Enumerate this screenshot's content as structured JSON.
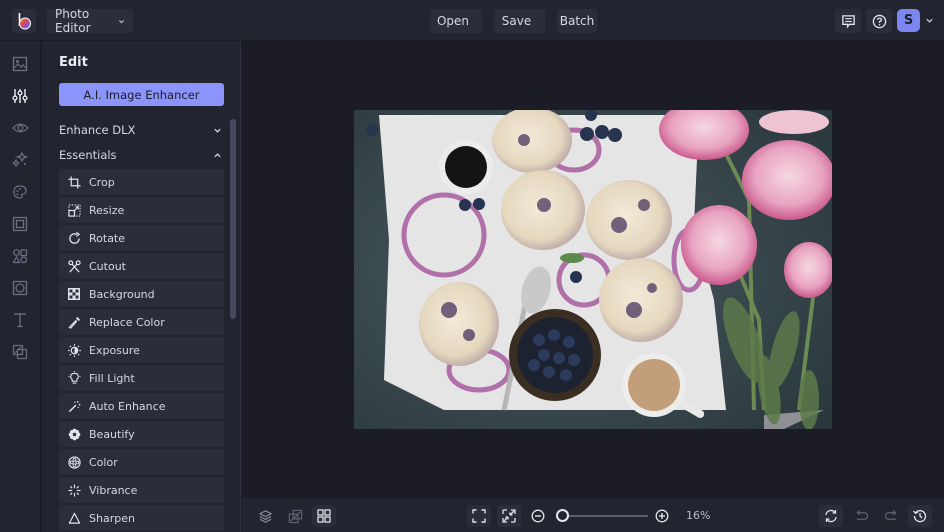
{
  "app": {
    "logo": "befunky-logo",
    "mode_selector": {
      "label": "Photo Editor",
      "icon": "chevron-down-icon"
    }
  },
  "topbar": {
    "menu": [
      {
        "label": "Open",
        "icon": "chevron-down-icon"
      },
      {
        "label": "Save",
        "icon": "chevron-down-icon"
      },
      {
        "label": "Batch"
      }
    ],
    "right_icons": [
      "comment-icon",
      "help-icon"
    ],
    "avatar_initial": "S",
    "accent": "#7c86f0"
  },
  "rail": {
    "items": [
      {
        "icon": "image-manager-icon",
        "active": false
      },
      {
        "icon": "sliders-icon",
        "active": true
      },
      {
        "icon": "eye-icon",
        "active": false
      },
      {
        "icon": "sparkles-icon",
        "active": false
      },
      {
        "icon": "palette-icon",
        "active": false
      },
      {
        "icon": "frame-icon",
        "active": false
      },
      {
        "icon": "shapes-icon",
        "active": false
      },
      {
        "icon": "texture-icon",
        "active": false
      },
      {
        "icon": "text-icon",
        "active": false
      },
      {
        "icon": "overlay-icon",
        "active": false
      }
    ]
  },
  "panel": {
    "title": "Edit",
    "ai_button": "A.I. Image Enhancer",
    "sections": [
      {
        "label": "Enhance DLX",
        "expanded": false
      },
      {
        "label": "Essentials",
        "expanded": true
      }
    ],
    "tools": [
      {
        "label": "Crop",
        "icon": "crop-icon"
      },
      {
        "label": "Resize",
        "icon": "resize-icon"
      },
      {
        "label": "Rotate",
        "icon": "rotate-icon"
      },
      {
        "label": "Cutout",
        "icon": "scissors-icon"
      },
      {
        "label": "Background",
        "icon": "checkerboard-icon"
      },
      {
        "label": "Replace Color",
        "icon": "eyedropper-icon"
      },
      {
        "label": "Exposure",
        "icon": "exposure-icon"
      },
      {
        "label": "Fill Light",
        "icon": "lightbulb-icon"
      },
      {
        "label": "Auto Enhance",
        "icon": "magic-wand-icon"
      },
      {
        "label": "Beautify",
        "icon": "flower-icon"
      },
      {
        "label": "Color",
        "icon": "color-wheel-icon"
      },
      {
        "label": "Vibrance",
        "icon": "vibrance-icon"
      },
      {
        "label": "Sharpen",
        "icon": "triangle-icon"
      }
    ]
  },
  "canvas": {
    "image_description": "Top-down photo of blueberry scones, blueberries bowl, coffee cups and pink peonies"
  },
  "bottombar": {
    "left_icons": [
      "layers-icon",
      "compare-icon",
      "grid-icon"
    ],
    "view_icons": [
      "fit-screen-icon",
      "actual-size-icon"
    ],
    "zoom": {
      "value_percent": 16,
      "label": "16%",
      "minus_icon": "zoom-out-icon",
      "plus_icon": "zoom-in-icon",
      "slider_fraction": 0.02
    },
    "right_icons": [
      "refresh-icon",
      "undo-icon",
      "redo-icon",
      "history-icon"
    ]
  }
}
